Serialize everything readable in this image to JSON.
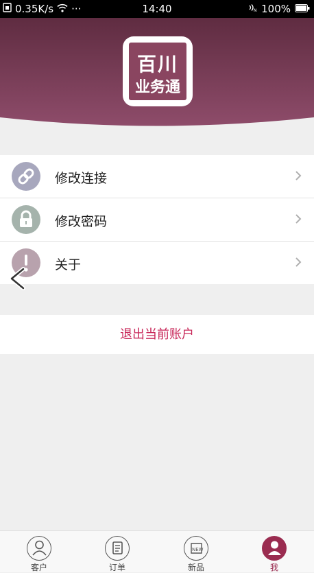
{
  "status": {
    "speed": "0.35K/s",
    "dots": "···",
    "time": "14:40",
    "battery": "100%"
  },
  "header": {
    "logo_line1": "百川",
    "logo_line2": "业务通",
    "bg_color": "#7e3d57"
  },
  "menu": {
    "items": [
      {
        "label": "修改连接",
        "icon": "link-icon",
        "color": "#a7a7bd"
      },
      {
        "label": "修改密码",
        "icon": "lock-icon",
        "color": "#a5b3ac"
      },
      {
        "label": "关于",
        "icon": "info-icon",
        "color": "#b8a2ad"
      }
    ]
  },
  "logout_label": "退出当前账户",
  "tabs": [
    {
      "label": "客户",
      "icon": "customer-icon"
    },
    {
      "label": "订单",
      "icon": "order-icon"
    },
    {
      "label": "新品",
      "icon": "new-product-icon",
      "badge": "NEW"
    },
    {
      "label": "我",
      "icon": "profile-icon",
      "active": true
    }
  ],
  "colors": {
    "accent": "#9a2c50",
    "logout_text": "#c8285a"
  }
}
